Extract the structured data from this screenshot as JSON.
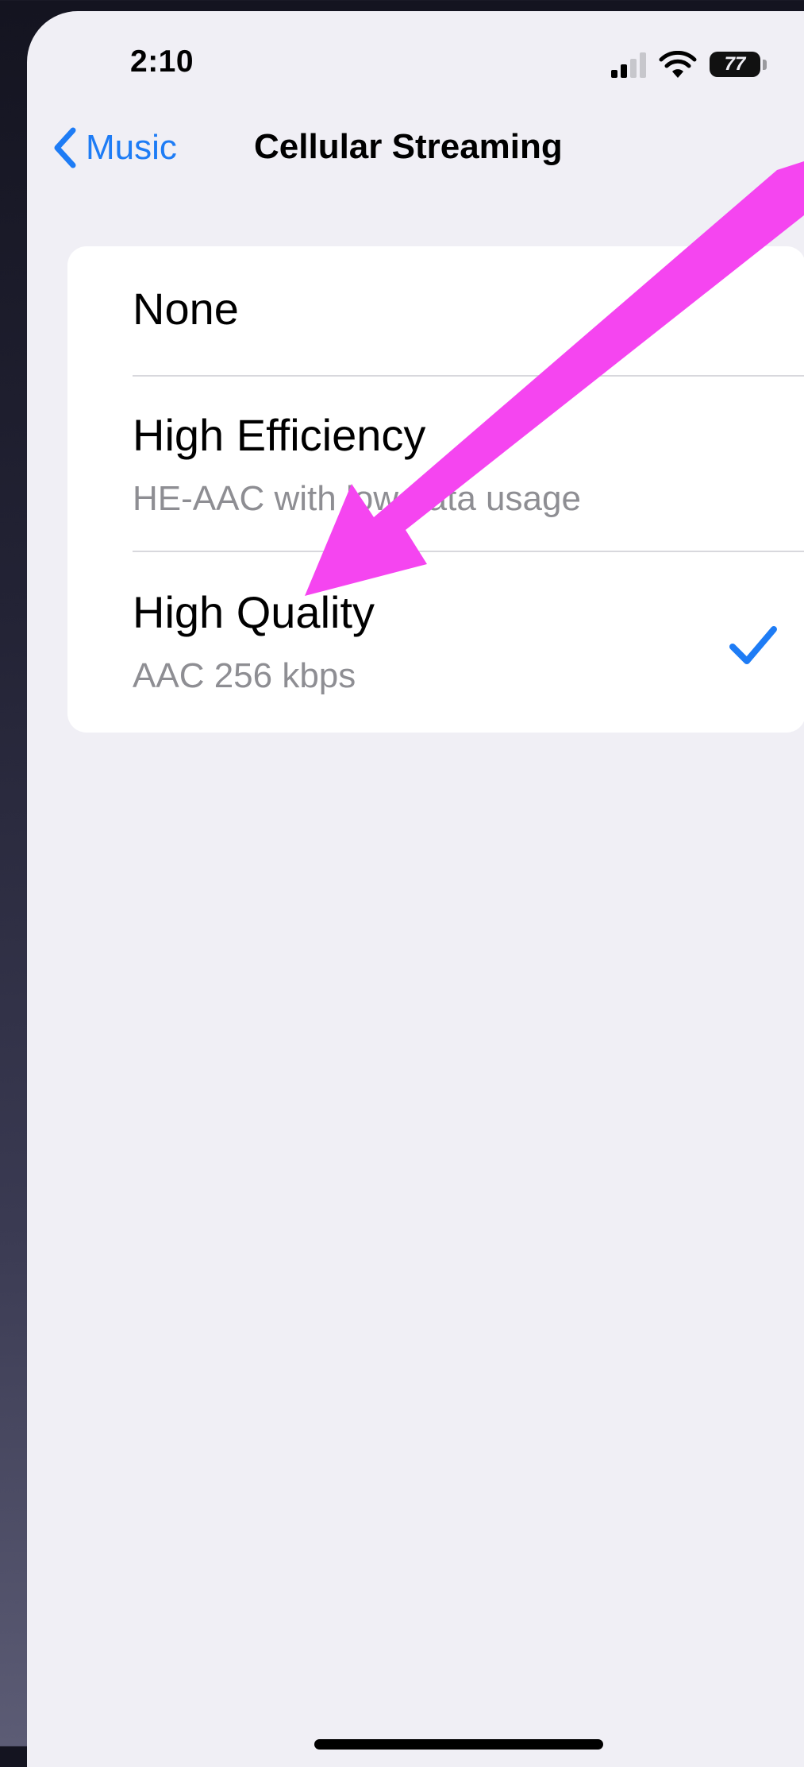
{
  "status_bar": {
    "time": "2:10",
    "battery_level": "77",
    "icons": [
      "signal-icon",
      "wifi-icon",
      "battery-icon"
    ]
  },
  "nav": {
    "back_label": "Music",
    "title": "Cellular Streaming"
  },
  "options": [
    {
      "title": "None",
      "subtitle": "",
      "selected": false
    },
    {
      "title": "High Efficiency",
      "subtitle": "HE-AAC with low data usage",
      "selected": false
    },
    {
      "title": "High Quality",
      "subtitle": "AAC 256 kbps",
      "selected": true
    }
  ],
  "colors": {
    "accent": "#1e7cf5",
    "annotation_arrow": "#f545f0",
    "background": "#f0eff5"
  }
}
